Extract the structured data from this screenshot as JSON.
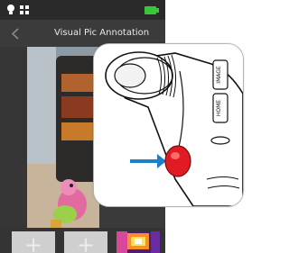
{
  "status_bar": {
    "icons": [
      "bulb-icon",
      "grid-icon",
      "battery-icon"
    ],
    "battery_color": "#37c837"
  },
  "app_bar": {
    "back_icon": "chevron-left-icon",
    "title": "Visual Pic Annotation"
  },
  "thumbnails": [
    {
      "type": "add",
      "label": "+"
    },
    {
      "type": "add",
      "label": "+"
    },
    {
      "type": "image",
      "description_icon": "thermal-image-thumbnail"
    }
  ],
  "colors": {
    "app_bg": "#2a2a2a",
    "appbar_bg": "#3b3b3b",
    "arrow": "#1f7fc6",
    "button_red": "#e01b24"
  },
  "camera_labels": {
    "label_top": "IMAGE",
    "label_bottom": "HOME"
  }
}
